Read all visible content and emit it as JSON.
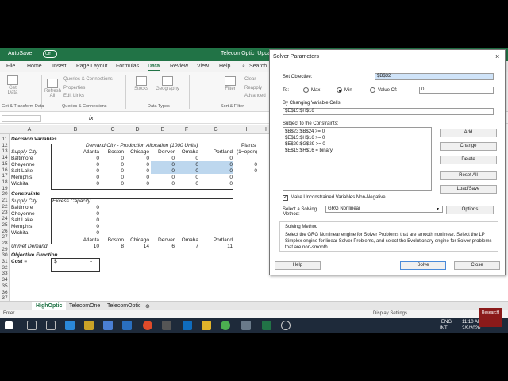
{
  "window": {
    "autosave": "AutoSave",
    "toggle": "Off",
    "title": "TelecomOptic_Update...",
    "search": "Search"
  },
  "menu": [
    "File",
    "Home",
    "Insert",
    "Page Layout",
    "Formulas",
    "Data",
    "Review",
    "View",
    "Help"
  ],
  "ribbon": {
    "get_data": "Get Data",
    "refresh_all": "Refresh All",
    "queries": "Queries & Connections",
    "properties": "Properties",
    "edit_links": "Edit Links",
    "stocks": "Stocks",
    "geography": "Geography",
    "filter": "Filter",
    "clear": "Clear",
    "reapply": "Reapply",
    "advanced": "Advanced",
    "grp_get": "Get & Transform Data",
    "grp_queries": "Queries & Connections",
    "grp_types": "Data Types",
    "grp_sort": "Sort & Filter"
  },
  "formula": {
    "fx": "fx",
    "namebox": ""
  },
  "columns": [
    "A",
    "B",
    "C",
    "D",
    "E",
    "F",
    "G",
    "H",
    "I"
  ],
  "rows": [
    "11",
    "12",
    "13",
    "14",
    "15",
    "16",
    "17",
    "18",
    "19",
    "20",
    "21",
    "22",
    "23",
    "24",
    "25",
    "26",
    "27",
    "28",
    "29",
    "30",
    "31",
    "32",
    "33",
    "34",
    "35",
    "36",
    "37"
  ],
  "sheet": {
    "decision_title": "Decision Variables",
    "demand_header": "Demand City - Production Allocation (1000 Units)",
    "plants": "Plants",
    "open": "(1=open)",
    "supply_city": "Supply City",
    "dest": [
      "Atlanta",
      "Boston",
      "Chicago",
      "Denver",
      "Omaha",
      "Portland"
    ],
    "cities": [
      "Baltimore",
      "Cheyenne",
      "Salt Lake",
      "Memphis",
      "Wichita"
    ],
    "alloc": [
      [
        "0",
        "0",
        "0",
        "0",
        "0",
        "0"
      ],
      [
        "0",
        "0",
        "0",
        "0",
        "0",
        "0"
      ],
      [
        "0",
        "0",
        "0",
        "0",
        "0",
        "0"
      ],
      [
        "0",
        "0",
        "0",
        "0",
        "0",
        "0"
      ],
      [
        "0",
        "0",
        "0",
        "0",
        "0",
        "0"
      ]
    ],
    "plant_vals": [
      "0",
      "0"
    ],
    "constraints_title": "Constraints",
    "excess": "Excess Capacity",
    "excess_vals": [
      "0",
      "0",
      "0",
      "0",
      "0"
    ],
    "unmet": "Unmet Demand",
    "unmet_vals": [
      "10",
      "8",
      "14",
      "6",
      "7",
      "11"
    ],
    "objective_title": "Objective Function",
    "cost_label": "Cost =",
    "cost_sym": "$",
    "cost_val": "-"
  },
  "tabs": [
    "HighOptic",
    "TelecomOne",
    "TelecomOptic"
  ],
  "status": {
    "enter": "Enter",
    "display": "Display Settings"
  },
  "taskbar": {
    "lang": "ENG",
    "region": "INTL",
    "time": "11:10 AM",
    "date": "2/9/2020",
    "badge": "ResearcH"
  },
  "solver": {
    "title": "Solver Parameters",
    "set_objective_label": "Set Objective:",
    "set_objective_value": "$B$32",
    "to_label": "To:",
    "max": "Max",
    "min": "Min",
    "value_of": "Value Of:",
    "value_of_val": "0",
    "changing_label": "By Changing Variable Cells:",
    "changing_value": "$E$15:$H$16",
    "subject_label": "Subject to the Constraints:",
    "constraints": [
      "$B$23:$B$24 >= 0",
      "$E$15:$H$16 >= 0",
      "$E$29:$G$29 >= 0",
      "$E$15:$H$16 = binary"
    ],
    "buttons": [
      "Add",
      "Change",
      "Delete",
      "Reset All",
      "Load/Save"
    ],
    "nonneg": "Make Unconstrained Variables Non-Negative",
    "method_label": "Select a Solving Method:",
    "method_value": "GRG Nonlinear",
    "options": "Options",
    "solving_method_title": "Solving Method",
    "solving_method_text": "Select the GRG Nonlinear engine for Solver Problems that are smooth nonlinear. Select the LP Simplex engine for linear Solver Problems, and select the Evolutionary engine for Solver problems that are non-smooth.",
    "help": "Help",
    "solve": "Solve",
    "close": "Close"
  },
  "colors": {
    "excel_green": "#217346",
    "highlight": "#bdd7ee"
  }
}
